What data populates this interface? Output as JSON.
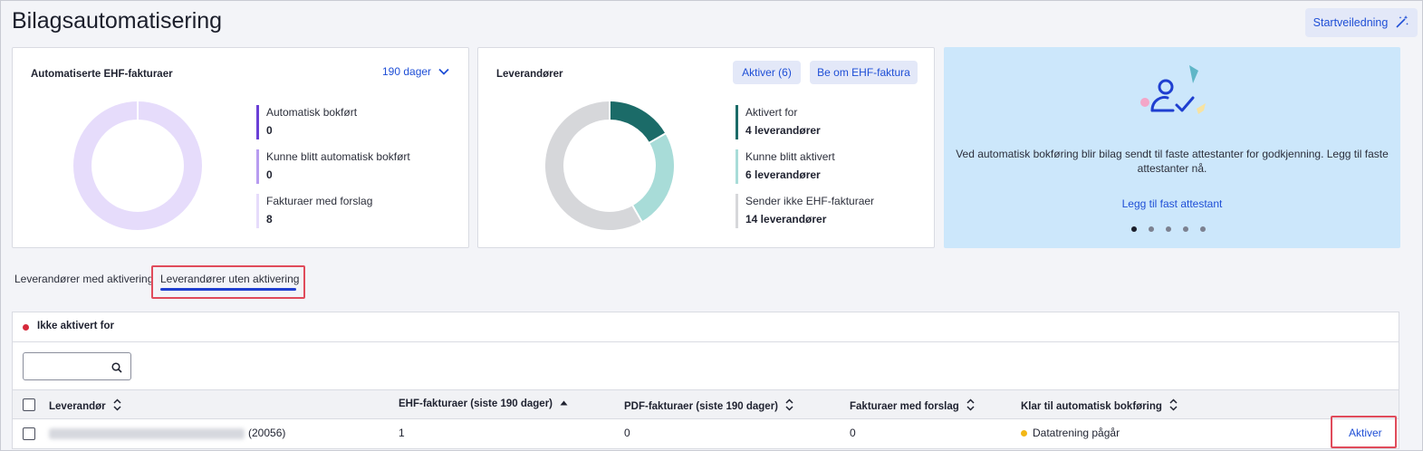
{
  "page": {
    "title": "Bilagsautomatisering"
  },
  "header": {
    "guide_label": "Startveiledning"
  },
  "ehf_card": {
    "title": "Automatiserte EHF-fakturaer",
    "period": "190 dager",
    "legend": [
      {
        "label": "Automatisk bokført",
        "value": "0",
        "color": "#6a3fd6"
      },
      {
        "label": "Kunne blitt automatisk bokført",
        "value": "0",
        "color": "#b79cf0"
      },
      {
        "label": "Fakturaer med forslag",
        "value": "8",
        "color": "#e6dcfb"
      }
    ],
    "donut": {
      "segments": [
        {
          "name": "Fakturaer med forslag",
          "value": 8,
          "color": "#e6dcfb"
        }
      ]
    }
  },
  "supplier_card": {
    "title": "Leverandører",
    "activate_label": "Aktiver (6)",
    "request_label": "Be om EHF-faktura",
    "legend": [
      {
        "label": "Aktivert for",
        "value": "4 leverandører",
        "color": "#1b6b68"
      },
      {
        "label": "Kunne blitt aktivert",
        "value": "6 leverandører",
        "color": "#a8dcd8"
      },
      {
        "label": "Sender ikke EHF-fakturaer",
        "value": "14 leverandører",
        "color": "#d6d7da"
      }
    ],
    "donut": {
      "segments": [
        {
          "name": "Aktivert for",
          "value": 4,
          "color": "#1b6b68"
        },
        {
          "name": "Kunne blitt aktivert",
          "value": 6,
          "color": "#a8dcd8"
        },
        {
          "name": "Sender ikke EHF-fakturaer",
          "value": 14,
          "color": "#d6d7da"
        }
      ]
    }
  },
  "promo": {
    "text": "Ved automatisk bokføring blir bilag sendt til faste attestanter for godkjenning. Legg til faste attestanter nå.",
    "link": "Legg til fast attestant",
    "dots_total": 5,
    "dot_active": 1
  },
  "tabs": [
    {
      "label": "Leverandører med aktivering",
      "selected": false
    },
    {
      "label": "Leverandører uten aktivering",
      "selected": true
    }
  ],
  "table": {
    "section_title": "Ikke aktivert for",
    "search_placeholder": "",
    "columns": [
      {
        "label": "Leverandør"
      },
      {
        "label": "EHF-fakturaer (siste 190 dager)"
      },
      {
        "label": "PDF-fakturaer (siste 190 dager)"
      },
      {
        "label": "Fakturaer med forslag"
      },
      {
        "label": "Klar til automatisk bokføring"
      }
    ],
    "rows": [
      {
        "supplier_id": "(20056)",
        "ehf": "1",
        "pdf": "0",
        "suggestions": "0",
        "status": "Datatrening pågår",
        "action": "Aktiver"
      }
    ]
  }
}
